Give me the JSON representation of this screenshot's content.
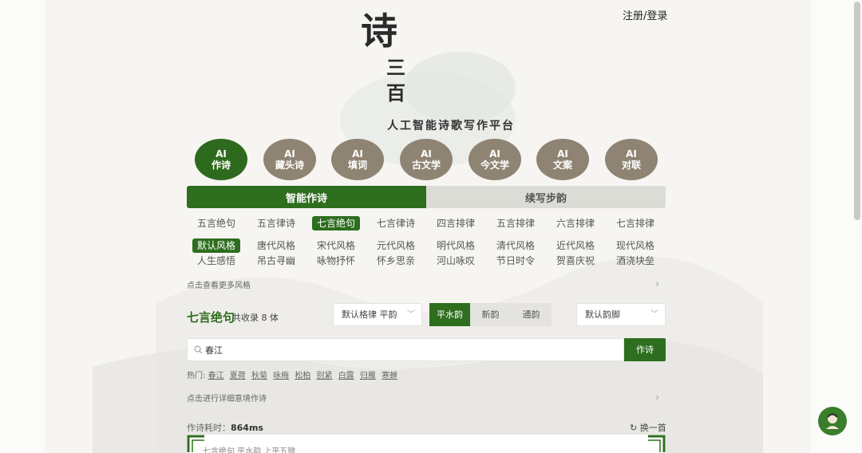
{
  "header": {
    "login": "注册/登录",
    "logo_main": "诗",
    "logo_sub1": "三",
    "logo_sub2": "百",
    "slogan": "人工智能诗歌写作平台"
  },
  "categories": [
    {
      "line1": "AI",
      "line2": "作诗",
      "active": true
    },
    {
      "line1": "AI",
      "line2": "藏头诗",
      "active": false
    },
    {
      "line1": "AI",
      "line2": "填词",
      "active": false
    },
    {
      "line1": "AI",
      "line2": "古文学",
      "active": false
    },
    {
      "line1": "AI",
      "line2": "今文学",
      "active": false
    },
    {
      "line1": "AI",
      "line2": "文案",
      "active": false
    },
    {
      "line1": "AI",
      "line2": "对联",
      "active": false
    }
  ],
  "tabs": {
    "active": "智能作诗",
    "inactive": "续写步韵"
  },
  "forms": [
    "五言绝句",
    "五言律诗",
    "七言绝句",
    "七言律诗",
    "四言排律",
    "五言排律",
    "六言排律",
    "七言排律"
  ],
  "styles_row1": [
    "默认风格",
    "唐代风格",
    "宋代风格",
    "元代风格",
    "明代风格",
    "清代风格",
    "近代风格",
    "现代风格"
  ],
  "styles_row2": [
    "人生感悟",
    "吊古寻幽",
    "咏物抒怀",
    "怀乡思亲",
    "河山咏叹",
    "节日时令",
    "贺喜庆祝",
    "酒浇块垒"
  ],
  "more_styles": "点击查看更多风格",
  "form_section": {
    "title": "七言绝句",
    "count": "共收录 8 体",
    "meter_select": "默认格律 平韵",
    "rhyme_options": [
      "平水韵",
      "新韵",
      "通韵"
    ],
    "rhyme_select": "默认韵脚"
  },
  "search": {
    "value": "春江",
    "button": "作诗"
  },
  "hot": {
    "label": "热门:",
    "items": [
      "春江",
      "夏荷",
      "秋菊",
      "咏梅",
      "松柏",
      "别紧",
      "白露",
      "归雁",
      "寒蝉"
    ]
  },
  "detail_link": "点击进行详细意境作诗",
  "result": {
    "time_label": "作诗耗时：",
    "time_value": "864ms",
    "refresh": "换一首",
    "meta": "七言绝句 平水韵 上平五微"
  },
  "colors": {
    "accent": "#2e6e1f",
    "inactive_circle": "#8f8473",
    "background": "#f6f5f2"
  }
}
